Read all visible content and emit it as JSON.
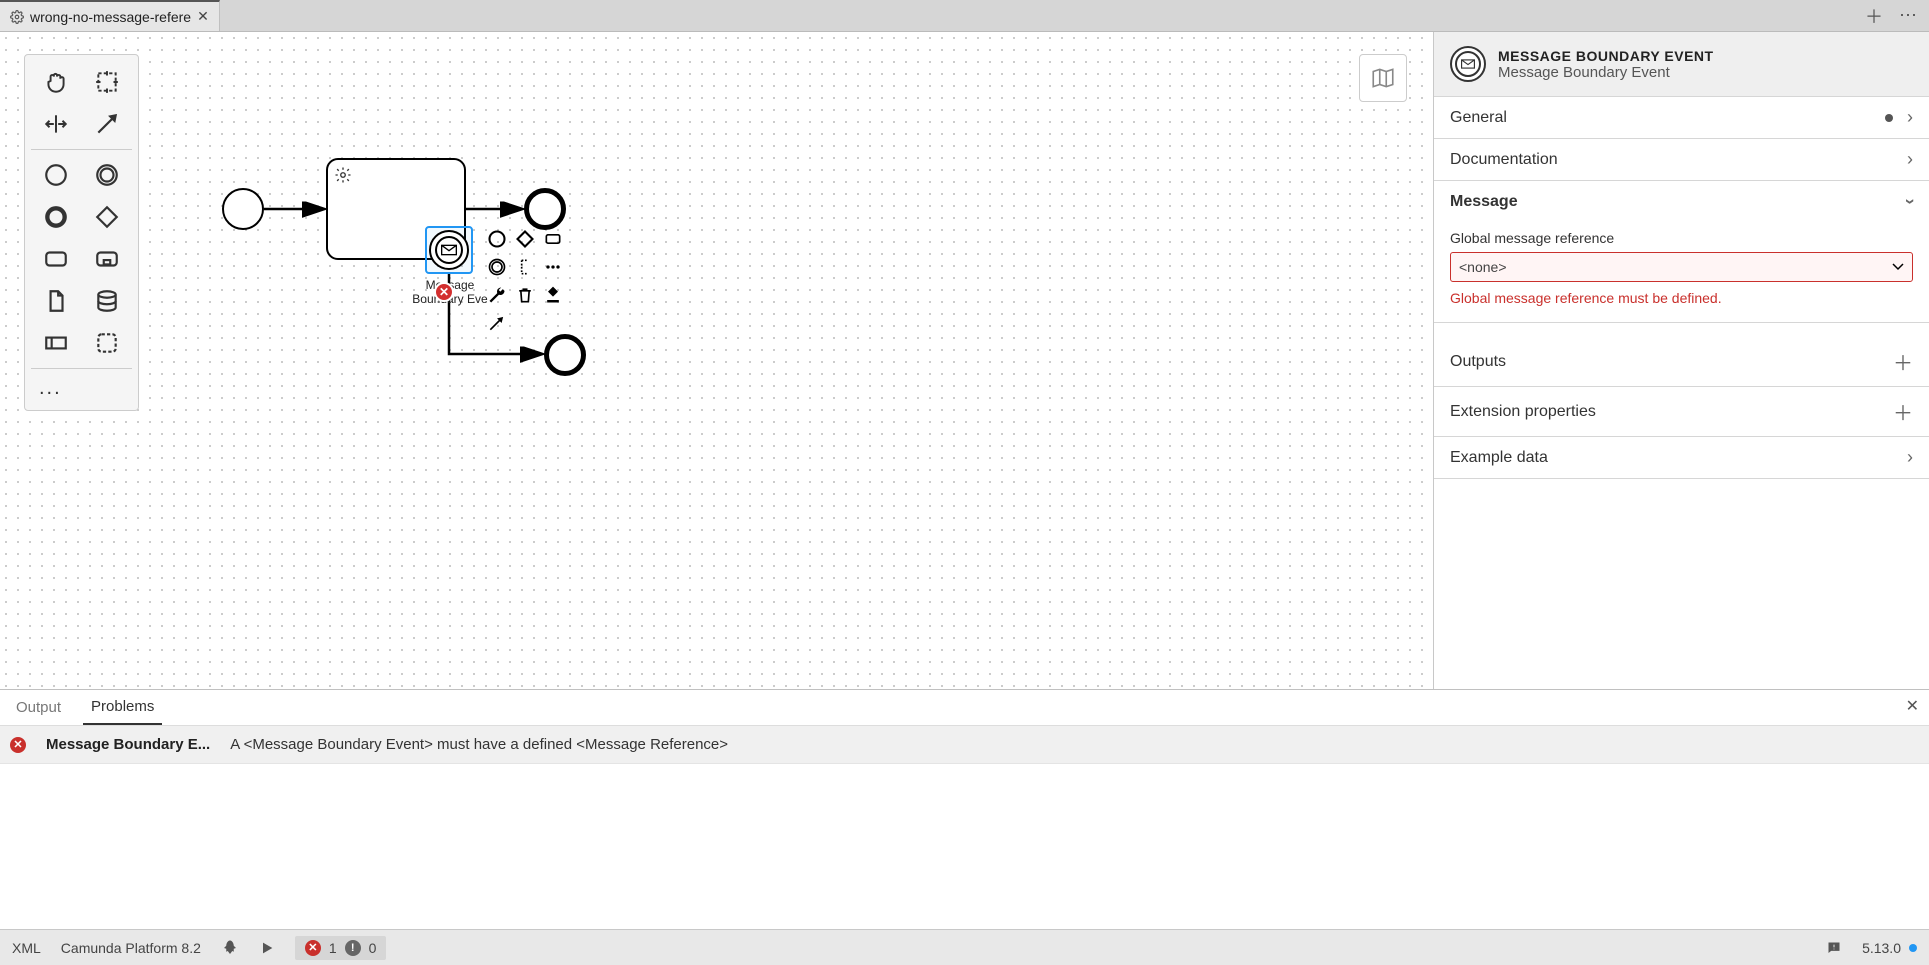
{
  "tab": {
    "title": "wrong-no-message-refere"
  },
  "palette_more": "...",
  "props": {
    "type": "MESSAGE BOUNDARY EVENT",
    "name": "Message Boundary Event",
    "sections": {
      "general": "General",
      "documentation": "Documentation",
      "message": "Message",
      "outputs": "Outputs",
      "extension": "Extension properties",
      "example": "Example data"
    },
    "message": {
      "field_label": "Global message reference",
      "value": "<none>",
      "error": "Global message reference must be defined."
    }
  },
  "diagram": {
    "boundary_label_line1": "Message",
    "boundary_label_line2": "Boundary Eve",
    "error_badge_glyph": "✕"
  },
  "bottom": {
    "tabs": {
      "output": "Output",
      "problems": "Problems"
    },
    "problem": {
      "source": "Message Boundary E...",
      "message": "A <Message Boundary Event> must have a defined <Message Reference>"
    }
  },
  "status": {
    "xml": "XML",
    "platform": "Camunda Platform 8.2",
    "errors": "1",
    "warnings": "0",
    "version": "5.13.0"
  }
}
